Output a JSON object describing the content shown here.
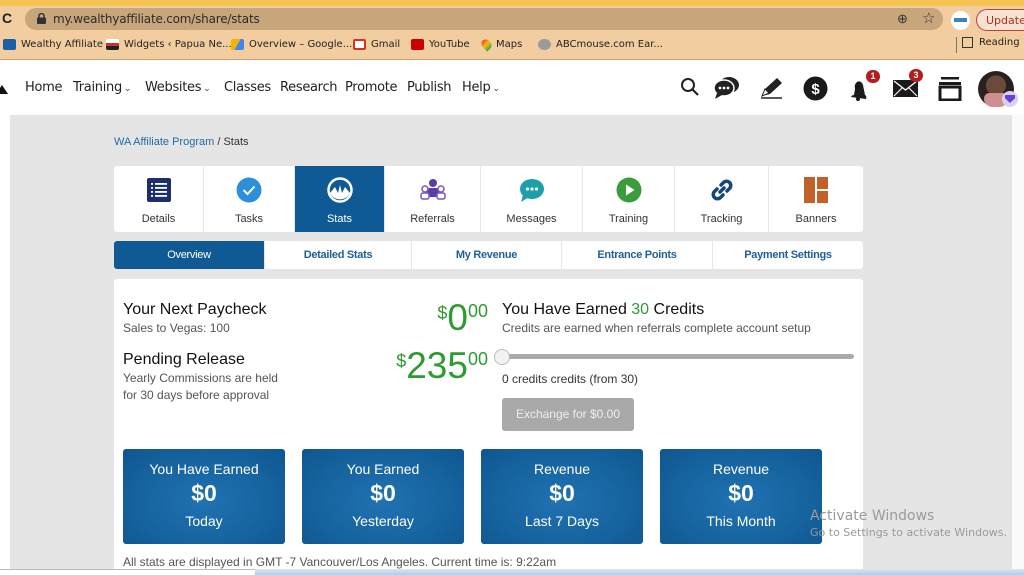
{
  "browser": {
    "url": "my.wealthyaffiliate.com/share/stats",
    "update_label": "Update",
    "bookmarks": [
      {
        "label": "Wealthy Affiliate",
        "icon": "wa-icon",
        "color": "#1c5fa8"
      },
      {
        "label": "Widgets ‹ Papua Ne...",
        "icon": "flag-icon",
        "color": "#c0392b"
      },
      {
        "label": "Overview – Google...",
        "icon": "google-ads-icon",
        "color": "#f4b400"
      },
      {
        "label": "Gmail",
        "icon": "gmail-icon",
        "color": "#d93025"
      },
      {
        "label": "YouTube",
        "icon": "youtube-icon",
        "color": "#cc0000"
      },
      {
        "label": "Maps",
        "icon": "maps-icon",
        "color": "#34a853"
      },
      {
        "label": "ABCmouse.com Ear...",
        "icon": "abcmouse-icon",
        "color": "#8a8a8a"
      }
    ],
    "reading_list_label": "Reading"
  },
  "nav": {
    "items": [
      {
        "label": "Home",
        "dropdown": false
      },
      {
        "label": "Training",
        "dropdown": true
      },
      {
        "label": "Websites",
        "dropdown": true
      },
      {
        "label": "Classes",
        "dropdown": false
      },
      {
        "label": "Research",
        "dropdown": false
      },
      {
        "label": "Promote",
        "dropdown": false
      },
      {
        "label": "Publish",
        "dropdown": false
      },
      {
        "label": "Help",
        "dropdown": true
      }
    ],
    "chevron": "⌄",
    "notifications_count": "1",
    "messages_count": "3"
  },
  "breadcrumb": {
    "parent": "WA Affiliate Program",
    "separator": " / ",
    "current": "Stats"
  },
  "tabs": [
    {
      "label": "Details",
      "icon": "list-icon",
      "active": false
    },
    {
      "label": "Tasks",
      "icon": "checkmark-icon",
      "active": false
    },
    {
      "label": "Stats",
      "icon": "stats-gauge-icon",
      "active": true
    },
    {
      "label": "Referrals",
      "icon": "people-icon",
      "active": false
    },
    {
      "label": "Messages",
      "icon": "chat-bubble-icon",
      "active": false
    },
    {
      "label": "Training",
      "icon": "play-icon",
      "active": false
    },
    {
      "label": "Tracking",
      "icon": "link-icon",
      "active": false
    },
    {
      "label": "Banners",
      "icon": "banners-icon",
      "active": false
    }
  ],
  "subtabs": [
    {
      "label": "Overview",
      "active": true
    },
    {
      "label": "Detailed Stats",
      "active": false
    },
    {
      "label": "My Revenue",
      "active": false
    },
    {
      "label": "Entrance Points",
      "active": false
    },
    {
      "label": "Payment Settings",
      "active": false
    }
  ],
  "overview": {
    "paycheck": {
      "title": "Your Next Paycheck",
      "subtitle": "Sales to Vegas: 100",
      "currency": "$",
      "dollars": "0",
      "cents": "00"
    },
    "pending": {
      "title": "Pending Release",
      "subtitle_line1": "Yearly Commissions are held",
      "subtitle_line2": "for 30 days before approval",
      "currency": "$",
      "dollars": "235",
      "cents": "00"
    },
    "credits": {
      "title_prefix": "You Have Earned ",
      "count": "30",
      "title_suffix": " Credits",
      "subtitle": "Credits are earned when referrals complete account setup",
      "slider_value": 0,
      "slider_max": 30,
      "slider_text": "0 credits credits (from 30)",
      "exchange_label": "Exchange for $0.00"
    },
    "cards": [
      {
        "top": "You Have Earned",
        "value": "$0",
        "bottom": "Today"
      },
      {
        "top": "You Earned",
        "value": "$0",
        "bottom": "Yesterday"
      },
      {
        "top": "Revenue",
        "value": "$0",
        "bottom": "Last 7 Days"
      },
      {
        "top": "Revenue",
        "value": "$0",
        "bottom": "This Month"
      }
    ],
    "footnote": "All stats are displayed in GMT -7 Vancouver/Los Angeles. Current time is: 9:22am"
  },
  "watermark": {
    "line1": "Activate Windows",
    "line2": "Go to Settings to activate Windows."
  },
  "colors": {
    "brand_blue": "#0f5a94",
    "money_green": "#2e9b31",
    "badge_red": "#b31d1d"
  }
}
